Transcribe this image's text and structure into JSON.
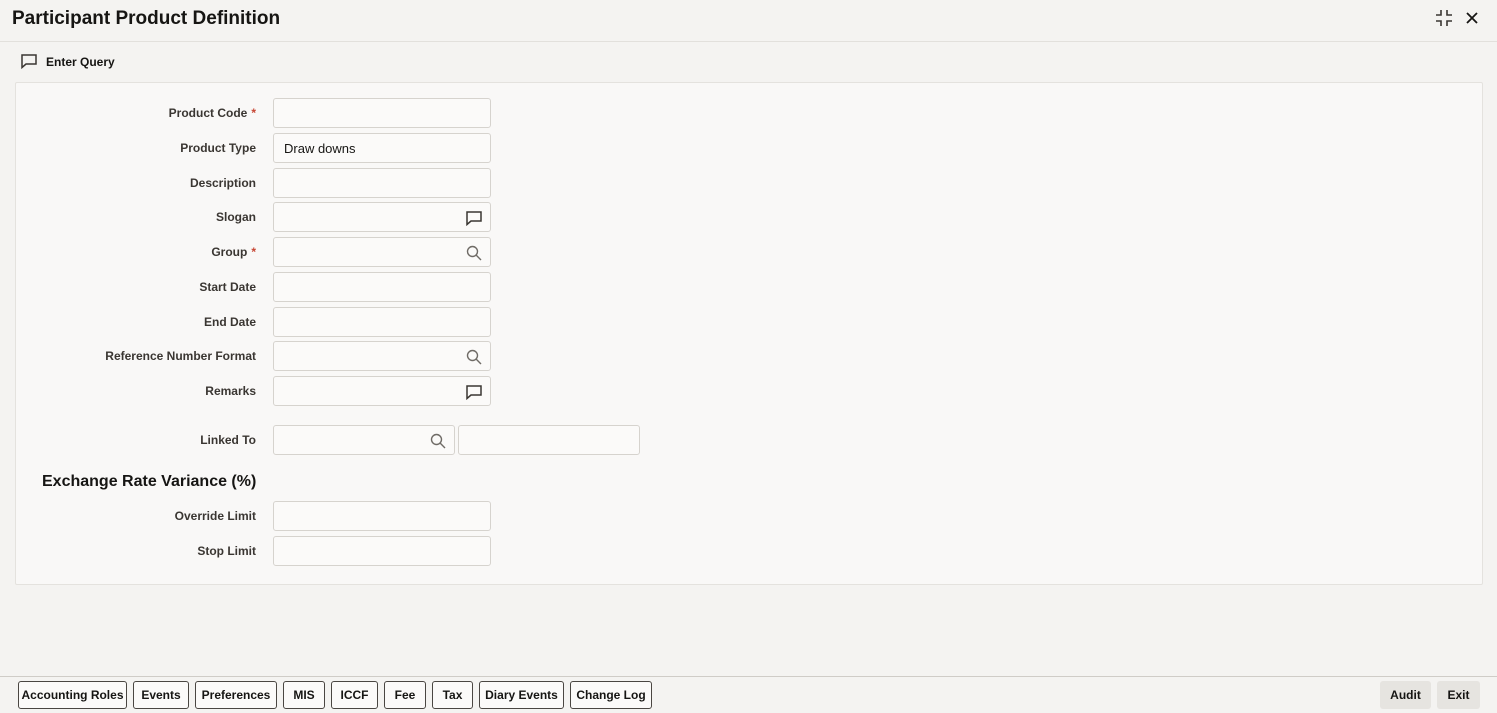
{
  "window": {
    "title": "Participant Product Definition"
  },
  "toolbar": {
    "enter_query": "Enter Query"
  },
  "form": {
    "product_code": {
      "label": "Product Code",
      "required": "*",
      "value": ""
    },
    "product_type": {
      "label": "Product Type",
      "value": "Draw downs"
    },
    "description": {
      "label": "Description",
      "value": ""
    },
    "slogan": {
      "label": "Slogan",
      "value": ""
    },
    "group": {
      "label": "Group",
      "required": "*",
      "value": ""
    },
    "start_date": {
      "label": "Start Date",
      "value": ""
    },
    "end_date": {
      "label": "End Date",
      "value": ""
    },
    "reference_number_format": {
      "label": "Reference Number Format",
      "value": ""
    },
    "remarks": {
      "label": "Remarks",
      "value": ""
    },
    "linked_to": {
      "label": "Linked To",
      "value": "",
      "description_value": ""
    }
  },
  "exchange_rate_variance": {
    "title": "Exchange Rate Variance (%)",
    "override_limit": {
      "label": "Override Limit",
      "value": ""
    },
    "stop_limit": {
      "label": "Stop Limit",
      "value": ""
    }
  },
  "footer": {
    "buttons": [
      "Accounting Roles",
      "Events",
      "Preferences",
      "MIS",
      "ICCF",
      "Fee",
      "Tax",
      "Diary Events",
      "Change Log"
    ],
    "audit": "Audit",
    "exit": "Exit"
  },
  "icons": {
    "maximize": "maximize-icon",
    "close": "close-icon",
    "chat": "chat-bubble-icon",
    "search": "search-icon"
  }
}
